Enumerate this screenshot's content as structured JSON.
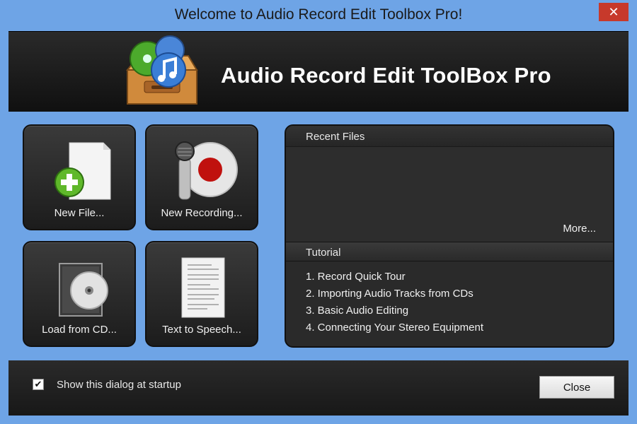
{
  "window": {
    "title": "Welcome to Audio Record Edit Toolbox Pro!",
    "close_glyph": "✕"
  },
  "banner": {
    "app_name": "Audio Record Edit ToolBox Pro",
    "logo_icon": "music-drawer-icon"
  },
  "tiles": [
    {
      "label": "New File...",
      "icon": "new-file-icon"
    },
    {
      "label": "New Recording...",
      "icon": "microphone-record-icon"
    },
    {
      "label": "Load from CD...",
      "icon": "cd-case-icon"
    },
    {
      "label": "Text to Speech...",
      "icon": "document-icon"
    }
  ],
  "recent": {
    "heading": "Recent Files",
    "more_label": "More..."
  },
  "tutorial": {
    "heading": "Tutorial",
    "items": [
      "1. Record Quick Tour",
      "2. Importing Audio Tracks from CDs",
      "3. Basic Audio Editing",
      "4. Connecting Your Stereo Equipment"
    ]
  },
  "footer": {
    "startup_label": "Show this dialog at startup",
    "startup_checked": true,
    "check_glyph": "✔",
    "close_label": "Close"
  },
  "colors": {
    "frame": "#6ea4e6",
    "panel": "#2a2a2a",
    "record_red": "#c0110e",
    "plus_green": "#5fb82a"
  }
}
